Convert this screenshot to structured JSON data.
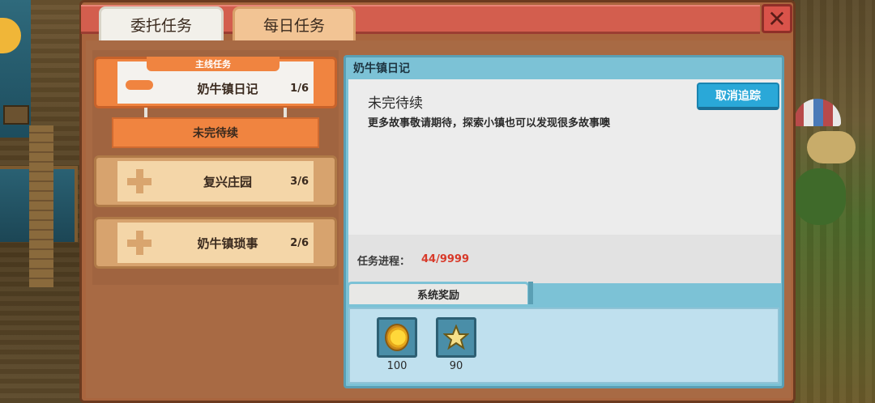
{
  "tabs": [
    {
      "label": "委托任务",
      "active": true
    },
    {
      "label": "每日任务",
      "active": false
    }
  ],
  "close_icon": "close-x-icon",
  "quests": [
    {
      "badge": "主线任务",
      "name": "奶牛镇日记",
      "count": "1/6",
      "active": true,
      "sub_status": "未完待续"
    },
    {
      "name": "复兴庄园",
      "count": "3/6",
      "active": false
    },
    {
      "name": "奶牛镇琐事",
      "count": "2/6",
      "active": false
    }
  ],
  "detail": {
    "header": "奶牛镇日记",
    "status_title": "未完待续",
    "description": "更多故事敬请期待，探索小镇也可以发现很多故事噢",
    "cancel_label": "取消追踪",
    "progress_label": "任务进程：",
    "progress_value": "44/9999"
  },
  "rewards": {
    "tab_label": "系统奖励",
    "items": [
      {
        "icon": "gold-coin-icon",
        "amount": "100"
      },
      {
        "icon": "star-icon",
        "amount": "90"
      }
    ]
  },
  "colors": {
    "title_bar": "#d35e4e",
    "active_quest": "#f08440",
    "cancel_button": "#2aa8d8",
    "progress_value": "#d83a2a",
    "detail_panel": "#7cc2d6"
  }
}
